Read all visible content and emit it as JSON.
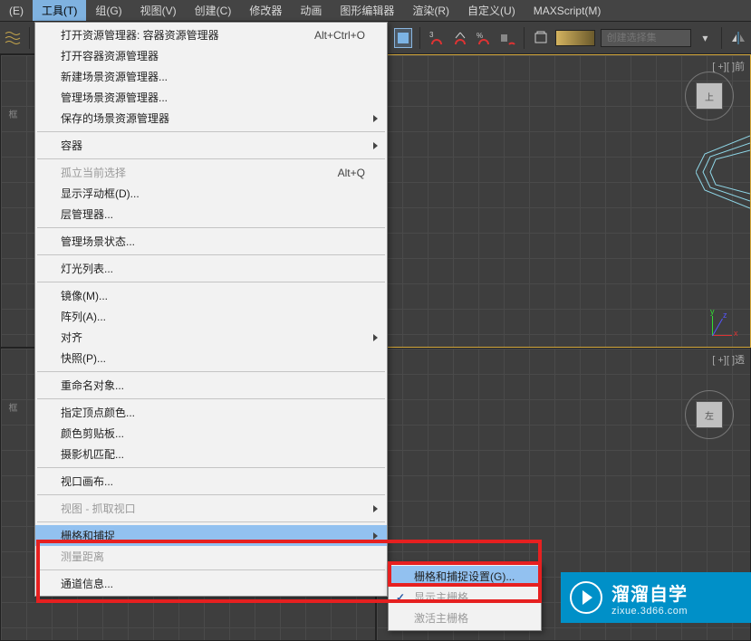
{
  "menu": {
    "items": [
      {
        "label": "(E)"
      },
      {
        "label": "工具(T)"
      },
      {
        "label": "组(G)"
      },
      {
        "label": "视图(V)"
      },
      {
        "label": "创建(C)"
      },
      {
        "label": "修改器"
      },
      {
        "label": "动画"
      },
      {
        "label": "图形编辑器"
      },
      {
        "label": "渲染(R)"
      },
      {
        "label": "自定义(U)"
      },
      {
        "label": "MAXScript(M)"
      }
    ],
    "active_index": 1
  },
  "toolbar": {
    "selection_set_placeholder": "创建选择集"
  },
  "viewports": {
    "top_right_label": "[ +][ ]前",
    "top_right_cube": "上",
    "bottom_right_label": "[ +][ ]透",
    "bottom_right_cube": "左",
    "left_label": "框"
  },
  "dropdown": {
    "items": [
      {
        "label": "打开资源管理器: 容器资源管理器",
        "shortcut": "Alt+Ctrl+O"
      },
      {
        "label": "打开容器资源管理器"
      },
      {
        "label": "新建场景资源管理器..."
      },
      {
        "label": "管理场景资源管理器..."
      },
      {
        "label": "保存的场景资源管理器",
        "has_sub": true
      },
      {
        "sep": true
      },
      {
        "label": "容器",
        "has_sub": true
      },
      {
        "sep": true
      },
      {
        "label": "孤立当前选择",
        "shortcut": "Alt+Q",
        "disabled": true
      },
      {
        "label": "显示浮动框(D)..."
      },
      {
        "label": "层管理器..."
      },
      {
        "sep": true
      },
      {
        "label": "管理场景状态..."
      },
      {
        "sep": true
      },
      {
        "label": "灯光列表..."
      },
      {
        "sep": true
      },
      {
        "label": "镜像(M)..."
      },
      {
        "label": "阵列(A)..."
      },
      {
        "label": "对齐",
        "has_sub": true
      },
      {
        "label": "快照(P)..."
      },
      {
        "sep": true
      },
      {
        "label": "重命名对象..."
      },
      {
        "sep": true
      },
      {
        "label": "指定顶点颜色..."
      },
      {
        "label": "颜色剪贴板..."
      },
      {
        "label": "摄影机匹配..."
      },
      {
        "sep": true
      },
      {
        "label": "视口画布..."
      },
      {
        "sep": true
      },
      {
        "label": "视图 - 抓取视口",
        "has_sub": true,
        "disabled": true
      },
      {
        "sep": true
      },
      {
        "label": "栅格和捕捉",
        "has_sub": true,
        "highlight": true
      },
      {
        "label": "测量距离",
        "disabled": true
      },
      {
        "sep": true
      },
      {
        "label": "通道信息..."
      }
    ]
  },
  "submenu": {
    "items": [
      {
        "label": "栅格和捕捉设置(G)...",
        "highlight": true
      },
      {
        "label": "显示主栅格",
        "checked": true,
        "disabled": true
      },
      {
        "label": "激活主栅格",
        "disabled": true
      }
    ]
  },
  "watermark": {
    "title": "溜溜自学",
    "sub": "zixue.3d66.com"
  }
}
